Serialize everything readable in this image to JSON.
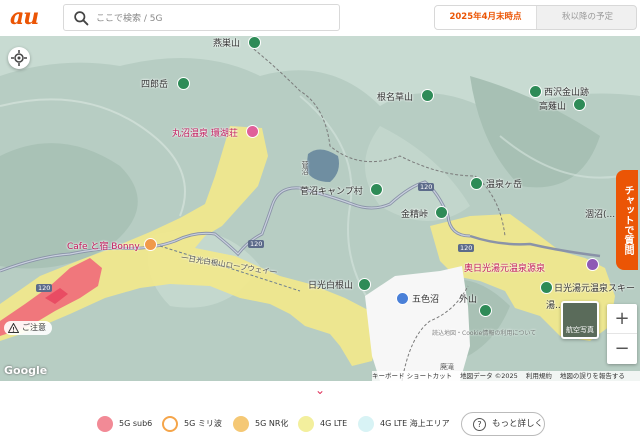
{
  "header": {
    "logo": "au",
    "search_placeholder": "ここで検索 / 5G",
    "tabs": [
      {
        "label": "2025年4月末時点",
        "active": true
      },
      {
        "label": "秋以降の予定",
        "active": false
      }
    ]
  },
  "map": {
    "labels": {
      "sukasan": "燕巣山",
      "shirou": "四郎岳",
      "nenamakusa": "根名草山",
      "takayadoro": "高薙山",
      "nishizawa": "西沢金山跡",
      "marunuma": "丸沼温泉 環湖荘",
      "suganuma": "菅沼",
      "suganuma_camp": "菅沼キャンプ村",
      "onsengatake": "温泉ヶ岳",
      "konsei": "金精峠",
      "yumoto_prefix": "涸沼(...",
      "cafe": "Cafe と宿 Bonny",
      "road": "一日光白根山ロープウェイ一",
      "nikko_shirane": "日光白根山",
      "goshikinuma": "五色沼",
      "sotoyama": "外山",
      "okunikko": "奥日光湯元温泉源泉",
      "yumoto_ski": "日光湯元温泉スキー",
      "yumoto_short": "湯...",
      "route_120_a": "120",
      "route_120_b": "120",
      "route_120_c": "120",
      "route_120_d": "120",
      "bottom_right": "廃滝"
    },
    "notice": "ご注意",
    "google": "Google",
    "chat": "チャットで質問",
    "zoom_in": "+",
    "zoom_out": "−",
    "satellite": "航空写真",
    "attribution": [
      "キーボード ショートカット",
      "地図データ ©2025",
      "利用規約",
      "地図の誤りを報告する"
    ],
    "faint_overlay": "読込地図・Cookie情報の利用について"
  },
  "bottom": {
    "chevron": "⌄"
  },
  "legend": {
    "items": [
      {
        "label": "5G sub6",
        "color": "#f28a96"
      },
      {
        "label": "5G ミリ波",
        "color": "#f5c38a"
      },
      {
        "label": "5G NR化",
        "color": "#f5c875"
      },
      {
        "label": "4G LTE",
        "color": "#f3ef9d"
      },
      {
        "label": "4G LTE 海上エリア",
        "color": "#d8f3f5"
      }
    ],
    "more": "もっと詳しく",
    "more_icon": "question-icon"
  },
  "colors": {
    "accent": "#eb5505",
    "lte_yellow": "#f1e88c",
    "sub6_red": "#ef6a7a"
  }
}
